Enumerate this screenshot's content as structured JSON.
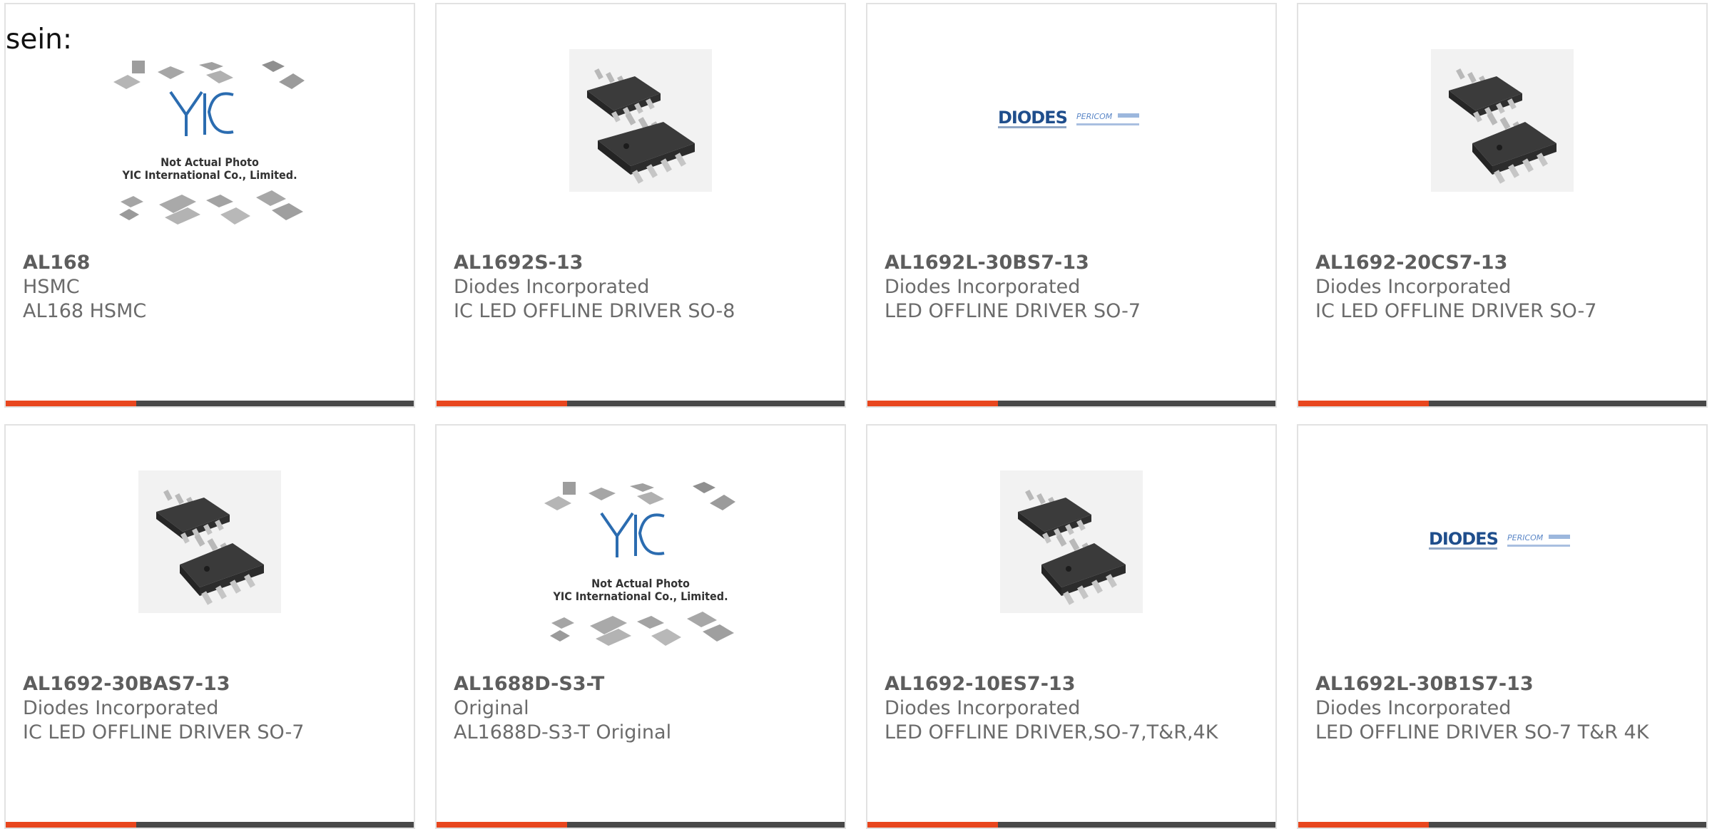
{
  "lead_text": "sein:",
  "image_texts": {
    "placeholder_brand": "YIC",
    "placeholder_line1": "Not Actual Photo",
    "placeholder_line2": "YIC International Co., Limited.",
    "diodes_logo": "DIODES",
    "pericom_logo": "PERICOM"
  },
  "colors": {
    "accent": "#e8461e",
    "bar": "#484848",
    "border": "#e2e2e2",
    "text": "#6b6b6b"
  },
  "products": [
    {
      "part": "AL168",
      "maker": "HSMC",
      "desc": "AL168 HSMC",
      "image": "placeholder-photo"
    },
    {
      "part": "AL1692S-13",
      "maker": "Diodes Incorporated",
      "desc": "IC LED OFFLINE DRIVER SO-8",
      "image": "so8-chip-photo"
    },
    {
      "part": "AL1692L-30BS7-13",
      "maker": "Diodes Incorporated",
      "desc": "LED OFFLINE DRIVER SO-7",
      "image": "diodes-pericom-logo"
    },
    {
      "part": "AL1692-20CS7-13",
      "maker": "Diodes Incorporated",
      "desc": "IC LED OFFLINE DRIVER SO-7",
      "image": "so7-chip-photo"
    },
    {
      "part": "AL1692-30BAS7-13",
      "maker": "Diodes Incorporated",
      "desc": "IC LED OFFLINE DRIVER SO-7",
      "image": "so7-chip-photo"
    },
    {
      "part": "AL1688D-S3-T",
      "maker": "Original",
      "desc": "AL1688D-S3-T Original",
      "image": "placeholder-photo"
    },
    {
      "part": "AL1692-10ES7-13",
      "maker": "Diodes Incorporated",
      "desc": "LED OFFLINE DRIVER,SO-7,T&R,4K",
      "image": "so7-chip-photo"
    },
    {
      "part": "AL1692L-30B1S7-13",
      "maker": "Diodes Incorporated",
      "desc": "LED OFFLINE DRIVER SO-7 T&R 4K",
      "image": "diodes-pericom-logo"
    }
  ]
}
